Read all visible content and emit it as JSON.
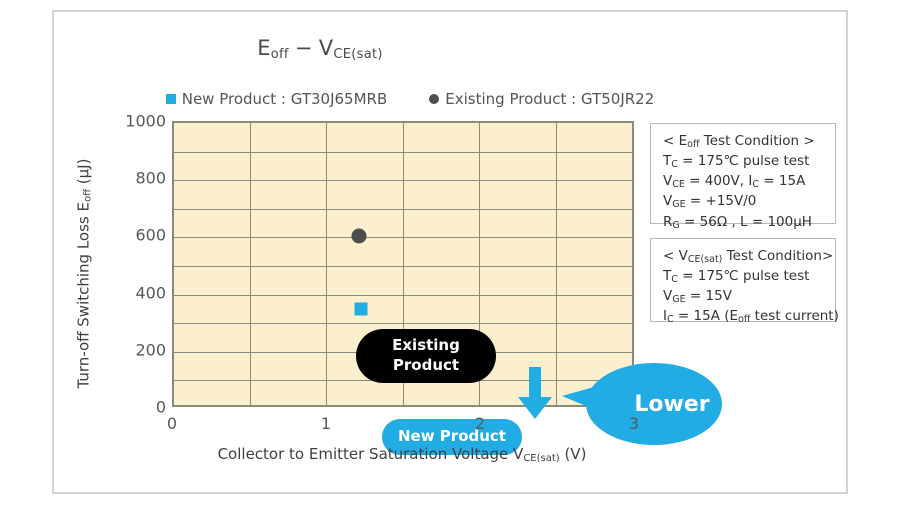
{
  "chart_data": {
    "type": "scatter",
    "title": "Eoff − VCE(sat)",
    "xlabel": "Collector to Emitter Saturation Voltage VCE(sat)  (V)",
    "ylabel": "Turn-off Switching Loss Eoff  (µJ)",
    "xlim": [
      0,
      3
    ],
    "ylim": [
      0,
      1000
    ],
    "xticks": [
      0,
      1,
      2,
      3
    ],
    "yticks": [
      0,
      200,
      400,
      600,
      800,
      1000
    ],
    "x_minor_step": 0.5,
    "y_minor_step": 100,
    "grid": true,
    "legend_position": "above-plot",
    "plot_background": "#FCEFCD",
    "series": [
      {
        "name": "New Product : GT30J65MRB",
        "marker": "square",
        "color": "#21ACE3",
        "points": [
          {
            "x": 1.2,
            "y": 350
          }
        ]
      },
      {
        "name": "Existing Product : GT50JR22",
        "marker": "circle",
        "color": "#4d4d4d",
        "points": [
          {
            "x": 1.2,
            "y": 605
          }
        ]
      }
    ],
    "annotations": [
      {
        "text": "Existing Product",
        "style": "black-pill"
      },
      {
        "text": "New Product",
        "style": "cyan-pill"
      },
      {
        "text": "Lower",
        "style": "cyan-bubble"
      },
      {
        "text": "down-arrow",
        "style": "cyan-arrow"
      }
    ]
  },
  "title": {
    "eoff_main": "E",
    "eoff_sub": "off",
    "dash": "−",
    "vce_main": "V",
    "vce_sub": "CE(sat)"
  },
  "legend": {
    "items": [
      {
        "label": "New Product : GT30J65MRB",
        "marker": "square",
        "color": "#21ACE3"
      },
      {
        "label": "Existing Product : GT50JR22",
        "marker": "circle",
        "color": "#4d4d4d"
      }
    ]
  },
  "axes": {
    "y": {
      "ticks": [
        "1000",
        "800",
        "600",
        "400",
        "200",
        "0"
      ],
      "title_part1": "Turn-off Switching Loss  E",
      "title_sub": "off",
      "title_part2": "  (µJ)"
    },
    "x": {
      "ticks": [
        "0",
        "1",
        "2",
        "3"
      ],
      "title_part1": "Collector to Emitter Saturation Voltage V",
      "title_sub": "CE(sat)",
      "title_part2": "  (V)"
    }
  },
  "annotations": {
    "existing_line1": "Existing",
    "existing_line2": "Product",
    "new_product": "New Product",
    "lower": "Lower"
  },
  "condition_boxes": {
    "eoff": {
      "heading_open": "<",
      "heading_main": " E",
      "heading_sub": "off",
      "heading_rest": " Test Condition >",
      "lines": [
        {
          "main": "T",
          "sub": "C",
          "rest": " = 175℃ pulse test"
        },
        {
          "main": "V",
          "sub": "CE",
          "rest": " = 400V, I",
          "sub2": "C",
          "rest2": " = 15A"
        },
        {
          "main": "V",
          "sub": "GE",
          "rest": " = +15V/0"
        },
        {
          "main": "R",
          "sub": "G",
          "rest": " = 56Ω , L = 100µH"
        }
      ]
    },
    "vcesat": {
      "heading_open": "<",
      "heading_main": " V",
      "heading_sub": "CE(sat)",
      "heading_rest": " Test Condition>",
      "lines": [
        {
          "main": "T",
          "sub": "C",
          "rest": " = 175℃ pulse test"
        },
        {
          "main": "V",
          "sub": "GE",
          "rest": " = 15V"
        },
        {
          "main": "I",
          "sub": "C",
          "rest": " = 15A (E",
          "sub2": "off",
          "rest2": "  test current)"
        }
      ]
    }
  }
}
